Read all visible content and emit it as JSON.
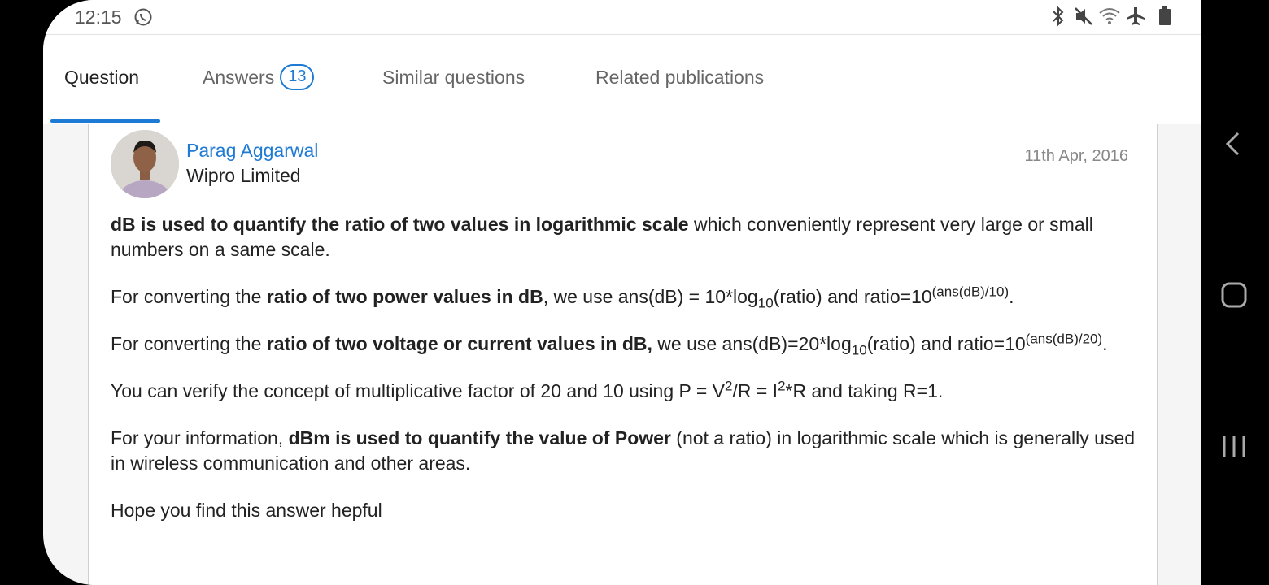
{
  "status_bar": {
    "time": "12:15",
    "icons": [
      "whatsapp-icon",
      "bluetooth-icon",
      "mute-icon",
      "wifi-icon",
      "airplane-icon",
      "battery-icon"
    ]
  },
  "tabs": [
    {
      "label": "Question",
      "active": true
    },
    {
      "label": "Answers",
      "badge": "13"
    },
    {
      "label": "Similar questions"
    },
    {
      "label": "Related publications"
    }
  ],
  "answer": {
    "author_name": "Parag Aggarwal",
    "author_org": "Wipro Limited",
    "date": "11th Apr, 2016",
    "p1": {
      "bold": "dB is used to quantify the ratio of two values in logarithmic scale",
      "text": " which conveniently represent very large or small numbers on a same scale."
    },
    "p2": {
      "pre": "For converting the ",
      "bold": "ratio of two power values in dB",
      "mid": ", we use ans(dB) = 10*log",
      "sub": "10",
      "mid2": "(ratio) and ratio=10",
      "sup": "(ans(dB)/10)",
      "end": "."
    },
    "p3": {
      "pre": "For converting the ",
      "bold": "ratio of two voltage or current values in dB,",
      "mid": " we use ans(dB)=20*log",
      "sub": "10",
      "mid2": "(ratio) and ratio=10",
      "sup": "(ans(dB)/20)",
      "end": "."
    },
    "p4": {
      "pre": "You can verify the concept of multiplicative factor of 20 and 10 using P = V",
      "sup1": "2",
      "mid": "/R = I",
      "sup2": "2",
      "end": "*R and taking R=1."
    },
    "p5": {
      "pre": "For your information, ",
      "bold": "dBm is used to quantify the value of Power",
      "end": " (not a ratio) in logarithmic scale which is generally used in wireless communication and other areas."
    },
    "p6": "Hope you find this answer hepful"
  },
  "nav_bar": [
    "back-icon",
    "home-icon",
    "recent-apps-icon"
  ],
  "colors": {
    "accent": "#1d7ad5",
    "background": "#f5f5f5"
  }
}
